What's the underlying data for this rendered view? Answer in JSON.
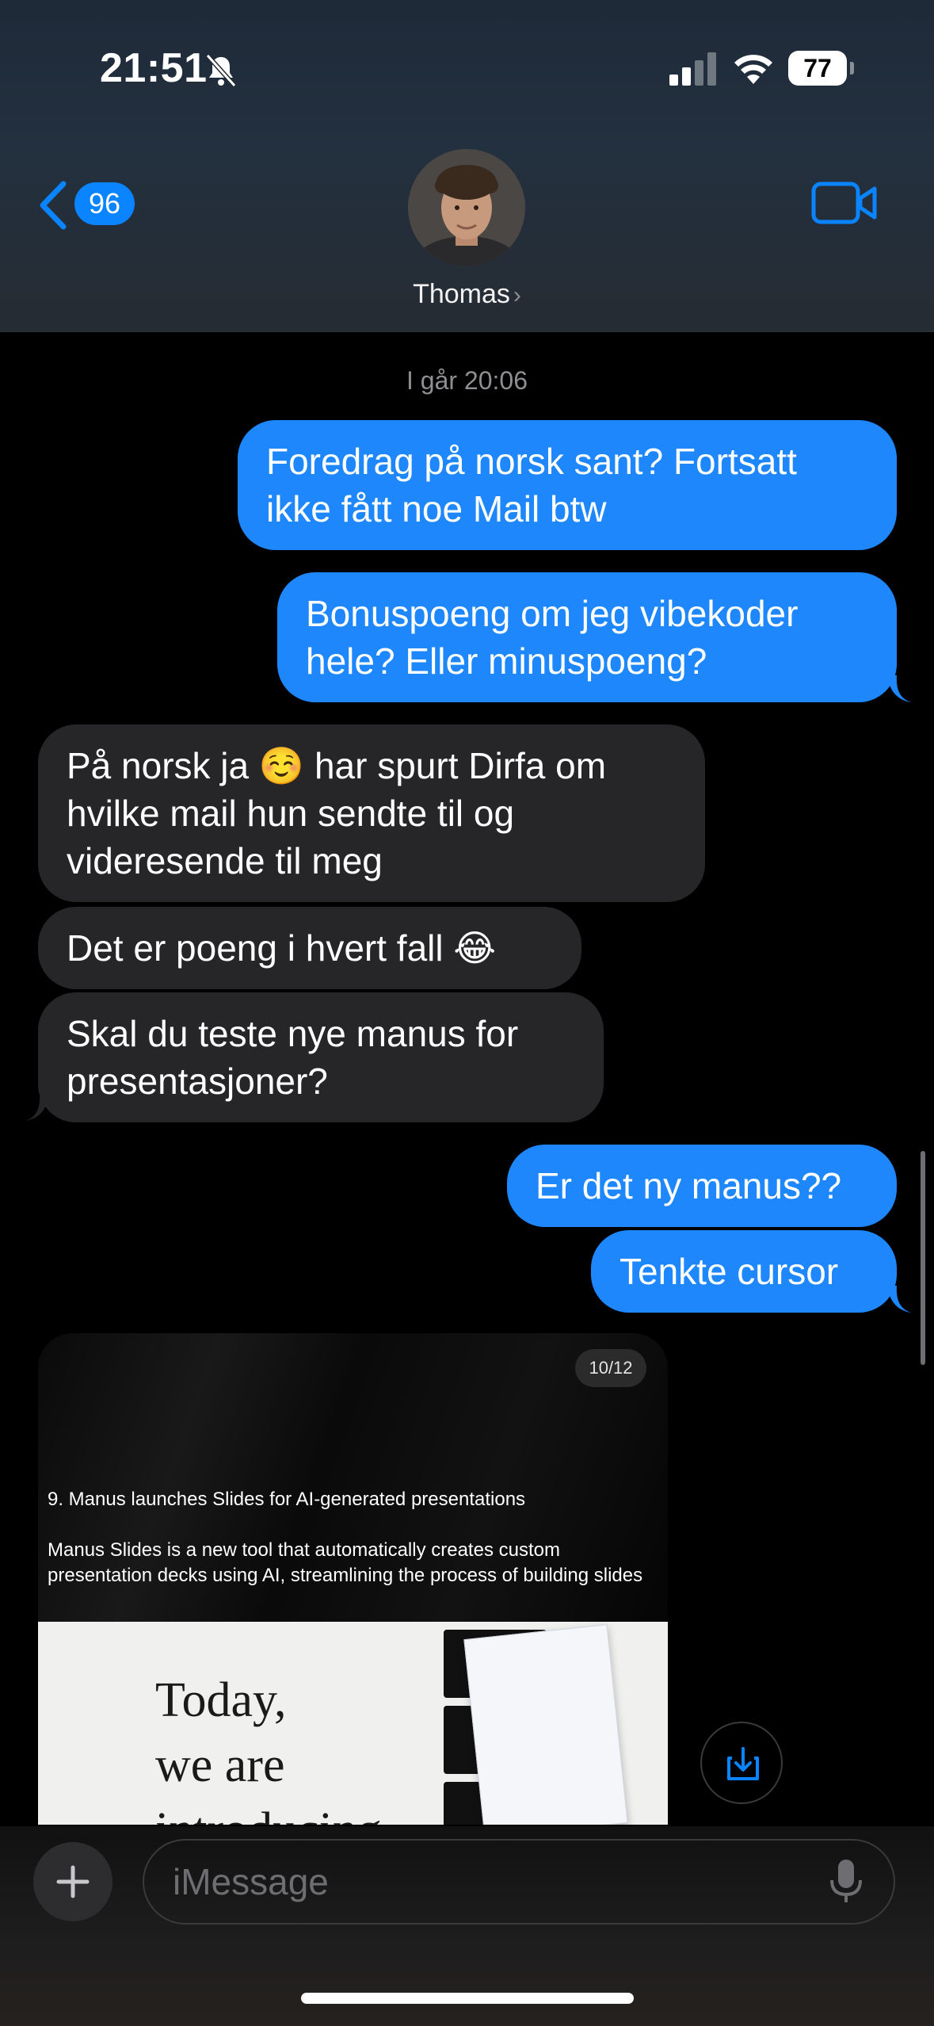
{
  "status_bar": {
    "time": "21:51",
    "battery": "77"
  },
  "header": {
    "back_count": "96",
    "contact_name": "Thomas",
    "contact_chevron": "›"
  },
  "conversation": {
    "timestamp": "I går 20:06",
    "messages": [
      {
        "from": "me",
        "text": "Foredrag på norsk sant? Fortsatt ikke fått noe Mail btw"
      },
      {
        "from": "me",
        "text": "Bonuspoeng om jeg vibekoder hele? Eller minuspoeng?"
      },
      {
        "from": "them",
        "text": "På norsk ja ☺️ har spurt Dirfa om hvilke mail hun sendte til og videresende til meg"
      },
      {
        "from": "them",
        "text": "Det er poeng i hvert fall 😂"
      },
      {
        "from": "them",
        "text": "Skal du teste nye manus for presentasjoner?"
      },
      {
        "from": "me",
        "text": "Er det ny manus??"
      },
      {
        "from": "me",
        "text": "Tenkte cursor"
      }
    ],
    "image_attachment": {
      "counter": "10/12",
      "title": "9. Manus launches Slides for AI-generated presentations",
      "description": "Manus Slides is a new tool that automatically creates custom presentation decks using AI, streamlining the process of building slides",
      "big_text_line1": "Today,",
      "big_text_line2": "we are",
      "big_text_line3": "introducing"
    }
  },
  "composer": {
    "placeholder": "iMessage"
  },
  "colors": {
    "accent": "#0a84ff",
    "sent_bubble": "#1d87fb",
    "received_bubble": "#262629"
  },
  "icons": [
    "bell-slash-icon",
    "signal-icon",
    "wifi-icon",
    "battery-icon",
    "back-chevron-icon",
    "video-call-icon",
    "download-icon",
    "plus-icon",
    "microphone-icon"
  ]
}
